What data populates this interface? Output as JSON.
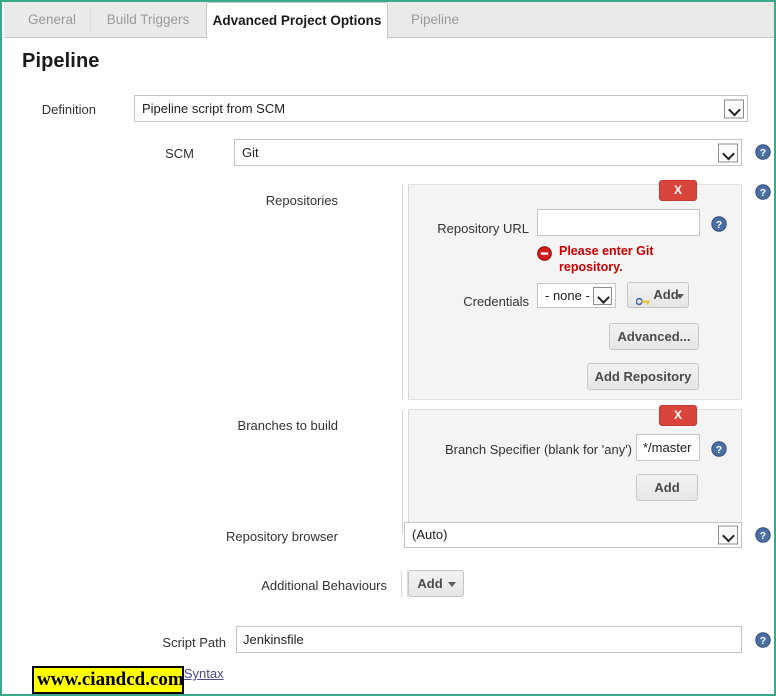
{
  "window": {
    "border_color": "#3aa98a"
  },
  "tabs": [
    {
      "label": "General",
      "active": false
    },
    {
      "label": "Build Triggers",
      "active": false
    },
    {
      "label": "Advanced Project Options",
      "active": true
    },
    {
      "label": "Pipeline",
      "active": false
    }
  ],
  "page": {
    "title": "Pipeline"
  },
  "definition": {
    "label": "Definition",
    "value": "Pipeline script from SCM",
    "icon": "chevron-down-icon"
  },
  "scm": {
    "label": "SCM",
    "value": "Git",
    "icon": "chevron-down-icon",
    "help_icon": "help-icon"
  },
  "repositories": {
    "label": "Repositories",
    "help_icon": "help-icon",
    "remove_label": "X",
    "url": {
      "label": "Repository URL",
      "value": "",
      "placeholder": "",
      "help_icon": "help-icon"
    },
    "error": {
      "icon": "error-icon",
      "text": "Please enter Git repository."
    },
    "credentials": {
      "label": "Credentials",
      "value": "- none -",
      "icon": "chevron-down-icon",
      "add_label": "Add",
      "add_icon": "key-icon",
      "add_caret_icon": "caret-down-icon"
    },
    "advanced_label": "Advanced...",
    "add_repository_label": "Add Repository"
  },
  "branches": {
    "label": "Branches to build",
    "help_icon": "help-icon",
    "remove_label": "X",
    "specifier": {
      "label": "Branch Specifier (blank for 'any')",
      "value": "*/master",
      "help_icon": "help-icon"
    },
    "add_label": "Add"
  },
  "repository_browser": {
    "label": "Repository browser",
    "value": "(Auto)",
    "icon": "chevron-down-icon",
    "help_icon": "help-icon"
  },
  "additional_behaviours": {
    "label": "Additional Behaviours",
    "add_label": "Add",
    "caret_icon": "caret-down-icon"
  },
  "script_path": {
    "label": "Script Path",
    "value": "Jenkinsfile",
    "help_icon": "help-icon"
  },
  "footer": {
    "pipeline_syntax_link": "Pipeline Syntax",
    "watermark": "www.ciandcd.com",
    "watermark_bg": "#ffff00"
  },
  "colors": {
    "danger": "#d9453b",
    "error_text": "#cc0000",
    "help_blue": "#4a6fa5",
    "accent_border": "#3aa98a"
  }
}
